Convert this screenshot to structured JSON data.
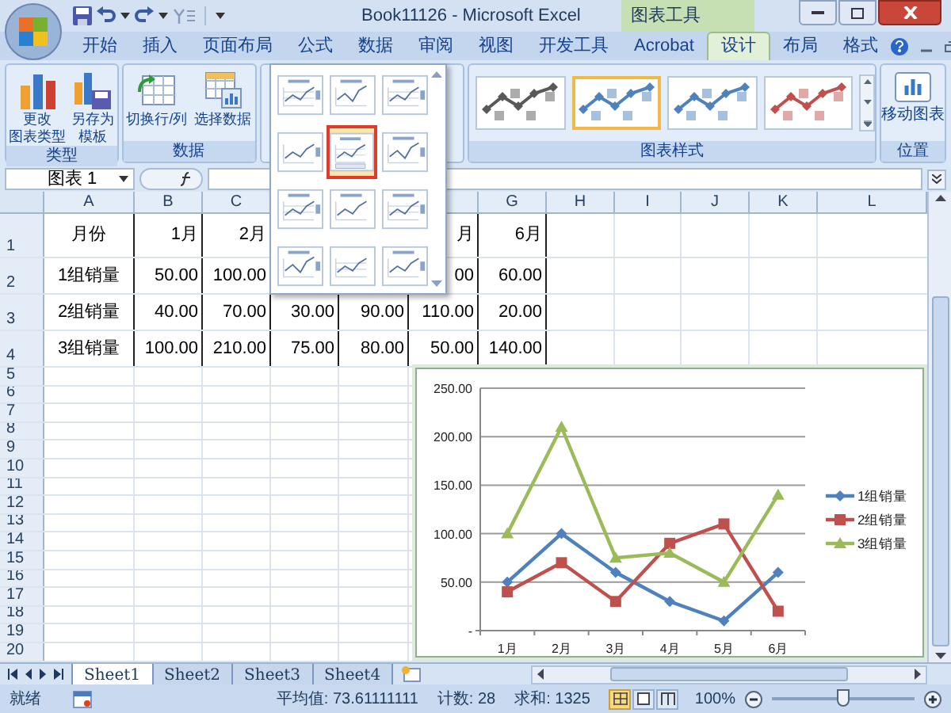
{
  "window": {
    "title": "Book11126 - Microsoft Excel",
    "context_title": "图表工具"
  },
  "tabs": [
    {
      "label": "开始",
      "selected": false
    },
    {
      "label": "插入",
      "selected": false
    },
    {
      "label": "页面布局",
      "selected": false
    },
    {
      "label": "公式",
      "selected": false
    },
    {
      "label": "数据",
      "selected": false
    },
    {
      "label": "审阅",
      "selected": false
    },
    {
      "label": "视图",
      "selected": false
    },
    {
      "label": "开发工具",
      "selected": false
    },
    {
      "label": "Acrobat",
      "selected": false
    },
    {
      "label": "设计",
      "selected": true
    },
    {
      "label": "布局",
      "selected": false
    },
    {
      "label": "格式",
      "selected": false
    }
  ],
  "ribbon_groups": [
    {
      "title": "类型",
      "buttons": [
        {
          "kind": "chart-type",
          "lines": [
            "更改",
            "图表类型"
          ]
        },
        {
          "kind": "template",
          "lines": [
            "另存为",
            "模板"
          ]
        }
      ]
    },
    {
      "title": "数据",
      "buttons": [
        {
          "kind": "switch",
          "lines": [
            "切换行/列"
          ]
        },
        {
          "kind": "select-data",
          "lines": [
            "选择数据"
          ]
        }
      ]
    }
  ],
  "chart_styles": {
    "title": "图表样式",
    "items": [
      {
        "selected": false,
        "color": "#595959"
      },
      {
        "selected": true,
        "color": "#4f81bd"
      },
      {
        "selected": false,
        "color": "#4f81bd"
      },
      {
        "selected": false,
        "color": "#c0504d"
      }
    ]
  },
  "position_group": {
    "title": "位置",
    "button": "移动图表"
  },
  "layout_gallery": {
    "items": [
      {
        "selected": false
      },
      {
        "selected": false
      },
      {
        "selected": false
      },
      {
        "selected": false
      },
      {
        "selected": true
      },
      {
        "selected": false
      },
      {
        "selected": false
      },
      {
        "selected": false
      },
      {
        "selected": false
      },
      {
        "selected": false
      },
      {
        "selected": false
      },
      {
        "selected": false
      }
    ]
  },
  "formula_bar": {
    "name_box": "图表 1"
  },
  "column_headers": [
    "A",
    "B",
    "C"
  ],
  "column_headers_after_menu": [
    "G",
    "H",
    "I",
    "J",
    "K",
    "L"
  ],
  "rows": [
    {
      "header": "1",
      "cells": [
        "月份",
        "1月",
        "2月"
      ],
      "cells_after_menu": [
        "月",
        "6月"
      ]
    },
    {
      "header": "2",
      "cells": [
        "1组销量",
        "50.00",
        "100.00"
      ],
      "cells_after_menu": [
        "00",
        "60.00"
      ]
    },
    {
      "header": "3",
      "cells": [
        "2组销量",
        "40.00",
        "70.00",
        "30.00",
        "90.00",
        "110.00",
        "20.00"
      ]
    },
    {
      "header": "4",
      "cells": [
        "3组销量",
        "100.00",
        "210.00",
        "75.00",
        "80.00",
        "50.00",
        "140.00"
      ]
    },
    {
      "header": "5"
    },
    {
      "header": "6"
    },
    {
      "header": "7"
    },
    {
      "header": "8"
    },
    {
      "header": "9"
    },
    {
      "header": "10"
    },
    {
      "header": "11"
    },
    {
      "header": "12"
    },
    {
      "header": "13"
    },
    {
      "header": "14"
    },
    {
      "header": "15"
    },
    {
      "header": "16"
    },
    {
      "header": "17"
    },
    {
      "header": "18"
    },
    {
      "header": "19"
    },
    {
      "header": "20"
    }
  ],
  "chart": {
    "chart_data": {
      "type": "line",
      "categories": [
        "1月",
        "2月",
        "3月",
        "4月",
        "5月",
        "6月"
      ],
      "series": [
        {
          "name": "1组销量",
          "color": "#4f81bd",
          "marker": "diamond",
          "values": [
            50,
            100,
            60,
            30,
            10,
            60
          ]
        },
        {
          "name": "2组销量",
          "color": "#c0504d",
          "marker": "square",
          "values": [
            40,
            70,
            30,
            90,
            110,
            20
          ]
        },
        {
          "name": "3组销量",
          "color": "#9bbb59",
          "marker": "triangle",
          "values": [
            100,
            210,
            75,
            80,
            50,
            140
          ]
        }
      ],
      "ylim": [
        0,
        250
      ],
      "yticks": [
        {
          "value": 0,
          "label": "-"
        },
        {
          "value": 50,
          "label": "50.00"
        },
        {
          "value": 100,
          "label": "100.00"
        },
        {
          "value": 150,
          "label": "150.00"
        },
        {
          "value": 200,
          "label": "200.00"
        },
        {
          "value": 250,
          "label": "250.00"
        }
      ],
      "grid": true,
      "legend": true
    }
  },
  "sheet_tabs": [
    {
      "label": "Sheet1",
      "selected": true
    },
    {
      "label": "Sheet2",
      "selected": false
    },
    {
      "label": "Sheet3",
      "selected": false
    },
    {
      "label": "Sheet4",
      "selected": false
    }
  ],
  "status_bar": {
    "ready": "就绪",
    "average": "平均值: 73.61111111",
    "count": "计数: 28",
    "sum": "求和: 1325",
    "zoom": "100%",
    "zoom_slider": {
      "level": 0.5
    },
    "views": [
      {
        "kind": "normal",
        "selected": true
      },
      {
        "kind": "layout",
        "selected": false
      },
      {
        "kind": "page-break",
        "selected": false
      }
    ]
  }
}
